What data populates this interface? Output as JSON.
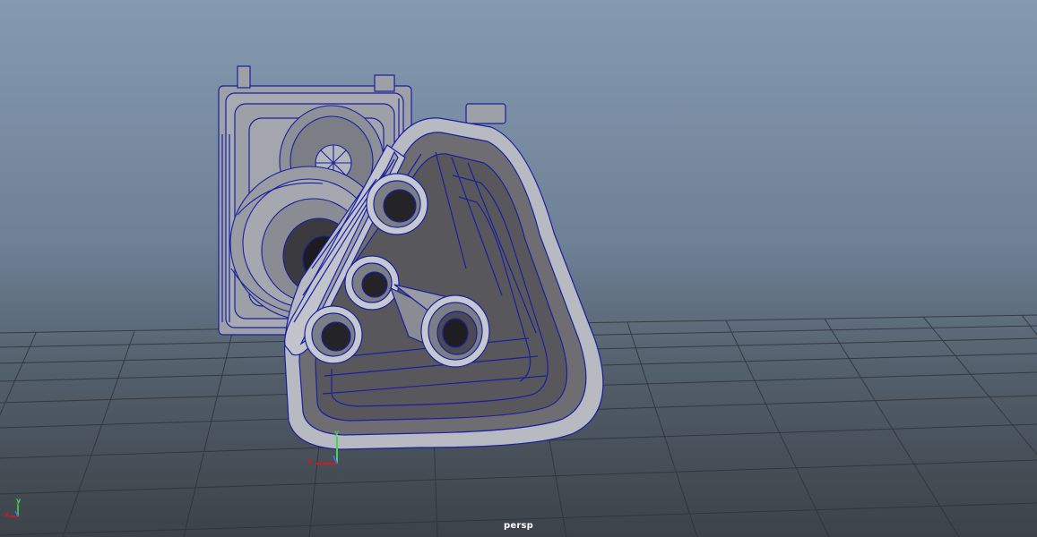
{
  "viewport": {
    "camera_label": "persp",
    "origin_axis": {
      "x_label": "x",
      "y_label": "y"
    },
    "view_cube_axis": {
      "x_label": "x",
      "y_label": "y"
    }
  },
  "colors": {
    "wire": "#1a1f9e",
    "shade": "#9ea0a8",
    "grid": "#2e3338",
    "axis_x": "#d81818",
    "axis_y": "#3fd84a",
    "axis_z": "#4a64e8"
  },
  "icons": [
    "axis-gizmo-icon",
    "origin-axis-icon"
  ]
}
